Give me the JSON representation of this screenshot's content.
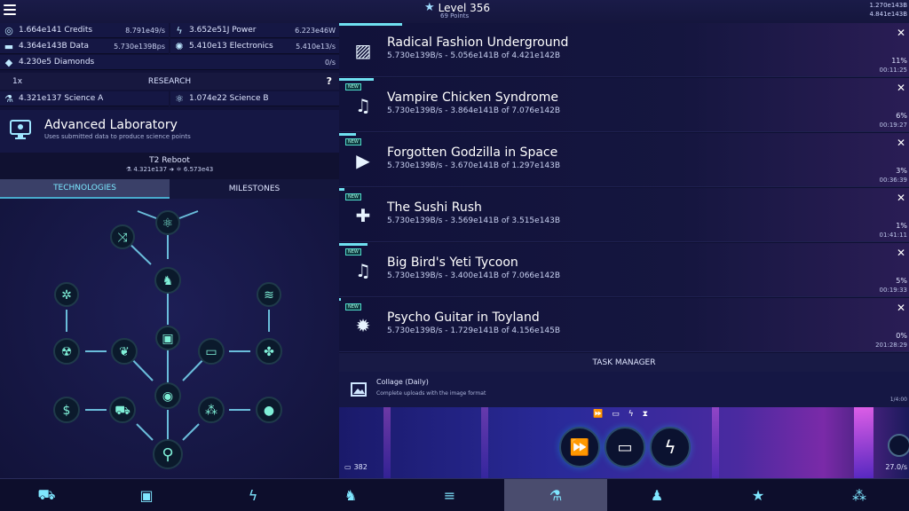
{
  "header": {
    "level": "Level 356",
    "points": "69 Points",
    "top_right_1": "1.270e143B",
    "top_right_2": "4.841e143B"
  },
  "resources": [
    {
      "icon": "credits-icon",
      "name": "1.664e141 Credits",
      "rate": "8.791e49/s"
    },
    {
      "icon": "power-icon",
      "name": "3.652e51J Power",
      "rate": "6.223e46W"
    },
    {
      "icon": "data-icon",
      "name": "4.364e143B Data",
      "rate": "5.730e139Bps"
    },
    {
      "icon": "electronics-icon",
      "name": "5.410e13 Electronics",
      "rate": "5.410e13/s"
    },
    {
      "icon": "diamond-icon",
      "name": "4.230e5 Diamonds",
      "rate": "0/s"
    }
  ],
  "research": {
    "label": "RESEARCH",
    "multiplier": "1x",
    "help": "?",
    "science_a": "4.321e137 Science A",
    "science_b": "1.074e22 Science B"
  },
  "lab": {
    "title": "Advanced Laboratory",
    "desc": "Uses submitted data to produce science points"
  },
  "reboot": {
    "title": "T2 Reboot",
    "cost": "4.321e137",
    "gain": "6.573e43"
  },
  "tabs": {
    "technologies": "TECHNOLOGIES",
    "milestones": "MILESTONES"
  },
  "uploads": [
    {
      "title": "Radical Fashion Underground",
      "meta": "5.730e139B/s - 5.056e141B of 4.421e142B",
      "pct": "11%",
      "time": "00:11:25",
      "icon": "image-icon",
      "isNew": false,
      "progress": 0.11
    },
    {
      "title": "Vampire Chicken Syndrome",
      "meta": "5.730e139B/s - 3.864e141B of 7.076e142B",
      "pct": "6%",
      "time": "00:19:27",
      "icon": "music-icon",
      "isNew": true,
      "progress": 0.06
    },
    {
      "title": "Forgotten Godzilla in Space",
      "meta": "5.730e139B/s - 3.670e141B of 1.297e143B",
      "pct": "3%",
      "time": "00:36:39",
      "icon": "video-icon",
      "isNew": true,
      "progress": 0.03
    },
    {
      "title": "The Sushi Rush",
      "meta": "5.730e139B/s - 3.569e141B of 3.515e143B",
      "pct": "1%",
      "time": "01:41:11",
      "icon": "gamepad-icon",
      "isNew": true,
      "progress": 0.01
    },
    {
      "title": "Big Bird's Yeti Tycoon",
      "meta": "5.730e139B/s - 3.400e141B of 7.066e142B",
      "pct": "5%",
      "time": "00:19:33",
      "icon": "music-icon",
      "isNew": true,
      "progress": 0.05
    },
    {
      "title": "Psycho Guitar in Toyland",
      "meta": "5.730e139B/s - 1.729e141B of 4.156e145B",
      "pct": "0%",
      "time": "201:28:29",
      "icon": "virus-icon",
      "isNew": true,
      "progress": 0.0
    }
  ],
  "new_badge": "NEW",
  "close_symbol": "✕",
  "task_manager": {
    "label": "TASK MANAGER",
    "title": "Collage (Daily)",
    "desc": "Complete uploads with the image format",
    "time": "1/4:00"
  },
  "footer": {
    "battery": "382",
    "rate": "27.0/s"
  },
  "colors": {
    "accent": "#6fe0f0",
    "bg": "#11123a",
    "panel": "#151744"
  }
}
